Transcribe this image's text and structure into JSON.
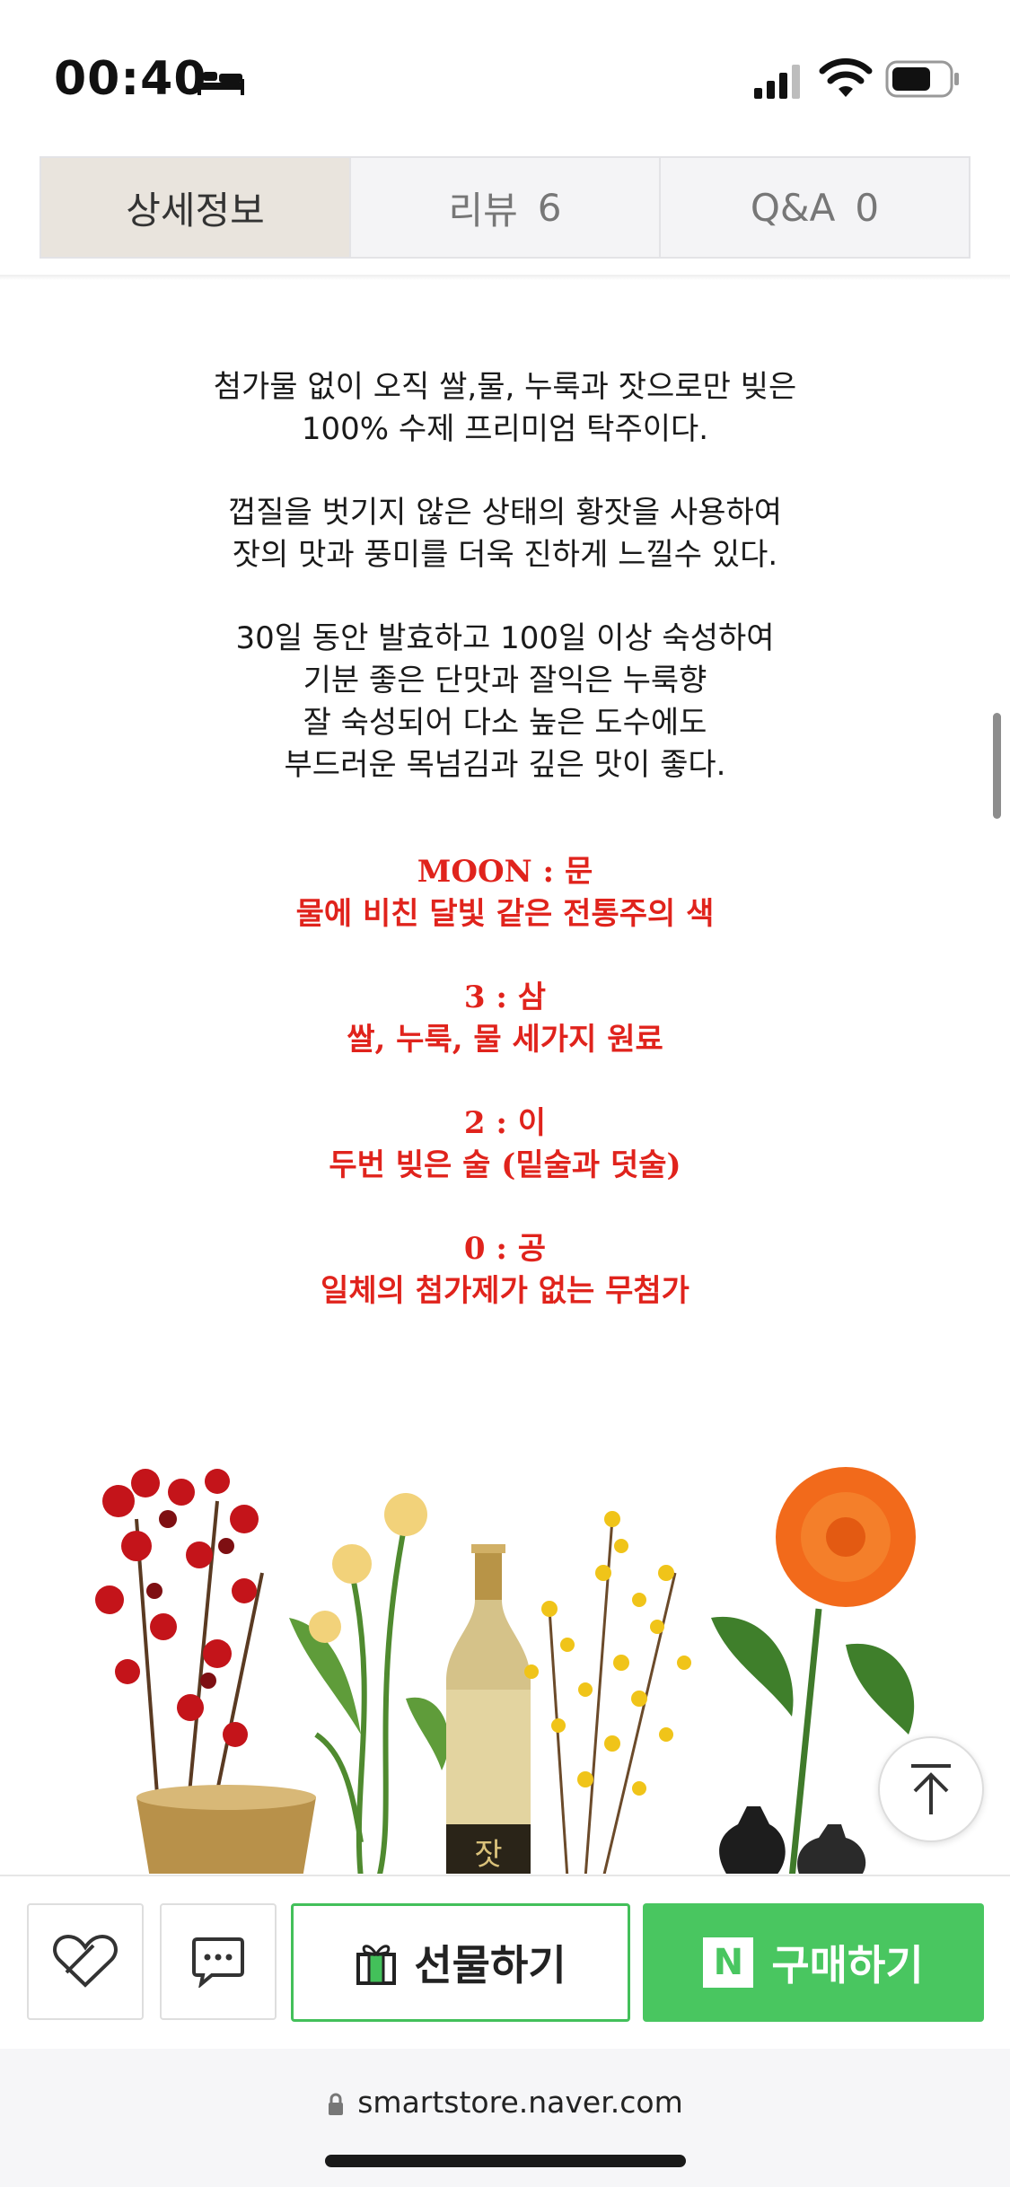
{
  "status_bar": {
    "time": "00:40",
    "icons": [
      "bed-icon",
      "signal-icon",
      "wifi-icon",
      "battery-icon"
    ]
  },
  "tabs": [
    {
      "label": "상세정보",
      "count": "",
      "active": true
    },
    {
      "label": "리뷰",
      "count": "6",
      "active": false
    },
    {
      "label": "Q&A",
      "count": "0",
      "active": false
    }
  ],
  "content": {
    "paragraphs": [
      [
        "첨가물 없이 오직 쌀,물, 누룩과 잣으로만 빚은",
        "100% 수제 프리미엄 탁주이다."
      ],
      [
        "껍질을 벗기지 않은 상태의 황잣을 사용하여",
        "잣의 맛과 풍미를 더욱 진하게 느낄수 있다."
      ],
      [
        "30일 동안 발효하고 100일 이상 숙성하여",
        "기분 좋은 단맛과 잘익은 누룩향",
        "잘 숙성되어 다소 높은 도수에도",
        "부드러운 목넘김과 깊은 맛이 좋다."
      ]
    ],
    "highlights": [
      [
        "MOON : 문",
        "물에 비친 달빛 같은 전통주의 색"
      ],
      [
        "3 : 삼",
        "쌀, 누룩, 물 세가지 원료"
      ],
      [
        "2 : 이",
        "두번 빚은 술 (밑술과 덧술)"
      ],
      [
        "0 : 공",
        "일체의 첨가제가 없는 무첨가"
      ]
    ],
    "highlight_color": "#e0231c",
    "bottle_label": "잣"
  },
  "actions": {
    "wishlist_icon": "heart-icon",
    "talk_icon": "chat-icon",
    "gift_label": "선물하기",
    "buy_label": "구매하기",
    "naver_badge": "N",
    "buy_color": "#49c660"
  },
  "browser": {
    "url": "smartstore.naver.com"
  }
}
